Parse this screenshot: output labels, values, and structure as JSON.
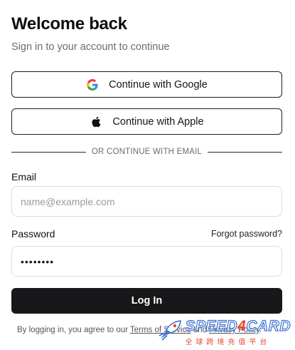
{
  "header": {
    "title": "Welcome back",
    "subtitle": "Sign in to your account to continue"
  },
  "oauth": {
    "google_label": "Continue with Google",
    "google_icon": "google-g-icon",
    "apple_label": "Continue with Apple",
    "apple_icon": "apple-icon"
  },
  "divider": {
    "text": "OR CONTINUE WITH EMAIL"
  },
  "form": {
    "email_label": "Email",
    "email_placeholder": "name@example.com",
    "email_value": "",
    "password_label": "Password",
    "password_value": "••••••••",
    "forgot_link": "Forgot password?",
    "submit_label": "Log In"
  },
  "legal": {
    "prefix": "By logging in, you agree to our ",
    "terms_link": "Terms of Service",
    "conjunction": " and ",
    "privacy_link": "Privacy Policy",
    "suffix": "."
  },
  "watermark": {
    "brand_part1": "SPEED",
    "brand_part2": "4",
    "brand_part3": "CARD",
    "tagline": "全球跨境充值平台"
  },
  "colors": {
    "primary_button": "#18181b",
    "border_dark": "#1f1f24",
    "input_border": "#dcdce0",
    "muted_text": "#6b6b72",
    "watermark_blue": "#3b6fd1",
    "watermark_red": "#e8462e"
  }
}
